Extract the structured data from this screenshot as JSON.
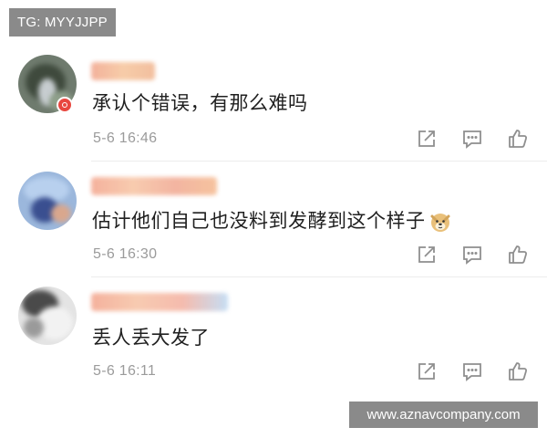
{
  "watermark_top": "TG: MYYJJPP",
  "watermark_bottom": "www.aznavcompany.com",
  "comments": [
    {
      "text": "承认个错误，有那么难吗",
      "time": "5-6 16:46",
      "has_badge": true
    },
    {
      "text": "估计他们自己也没料到发酵到这个样子",
      "time": "5-6 16:30",
      "emoji": "doge-emoji"
    },
    {
      "text": "丢人丢大发了",
      "time": "5-6 16:11"
    }
  ],
  "icons": {
    "share": "share-icon",
    "reply": "comment-icon",
    "like": "like-icon"
  },
  "colors": {
    "time_text": "#9b9b9b",
    "icon_stroke": "#8f8f8f",
    "badge": "#e8473f",
    "watermark_bg": "#8a8a8a"
  }
}
